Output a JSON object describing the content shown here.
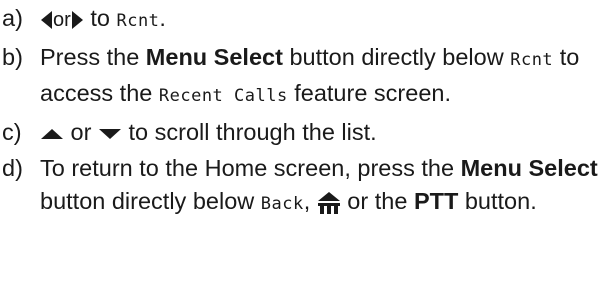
{
  "steps": [
    {
      "letter": "a)",
      "parts": [
        {
          "t": "icon",
          "name": "left-arrow-icon",
          "icon": "tri-left"
        },
        {
          "t": "text",
          "v": "or",
          "cls": "small"
        },
        {
          "t": "icon",
          "name": "right-arrow-icon",
          "icon": "tri-right"
        },
        {
          "t": "text",
          "v": " to "
        },
        {
          "t": "lcd",
          "v": "Rcnt"
        },
        {
          "t": "text",
          "v": "."
        }
      ]
    },
    {
      "letter": "b)",
      "parts": [
        {
          "t": "text",
          "v": "Press the "
        },
        {
          "t": "bold",
          "v": "Menu Select"
        },
        {
          "t": "text",
          "v": " button directly below "
        },
        {
          "t": "lcd",
          "v": "Rcnt"
        },
        {
          "t": "text",
          "v": " to access the "
        },
        {
          "t": "lcd",
          "v": "Recent Calls"
        },
        {
          "t": "text",
          "v": " feature screen."
        }
      ]
    },
    {
      "letter": "c)",
      "parts": [
        {
          "t": "icon",
          "name": "up-arrow-icon",
          "icon": "tri-up"
        },
        {
          "t": "text",
          "v": " or "
        },
        {
          "t": "icon",
          "name": "down-arrow-icon",
          "icon": "tri-down"
        },
        {
          "t": "text",
          "v": " to scroll through the list."
        }
      ]
    },
    {
      "letter": "d)",
      "parts": [
        {
          "t": "text",
          "v": "To return to the Home screen, press the "
        },
        {
          "t": "bold",
          "v": "Menu Select"
        },
        {
          "t": "text",
          "v": " button directly below "
        },
        {
          "t": "lcd",
          "v": "Back"
        },
        {
          "t": "text",
          "v": ", "
        },
        {
          "t": "icon",
          "name": "home-icon",
          "icon": "home"
        },
        {
          "t": "text",
          "v": " or the "
        },
        {
          "t": "bold",
          "v": "PTT"
        },
        {
          "t": "text",
          "v": " button."
        }
      ]
    }
  ],
  "colors": {
    "text": "#1a1a1a"
  }
}
